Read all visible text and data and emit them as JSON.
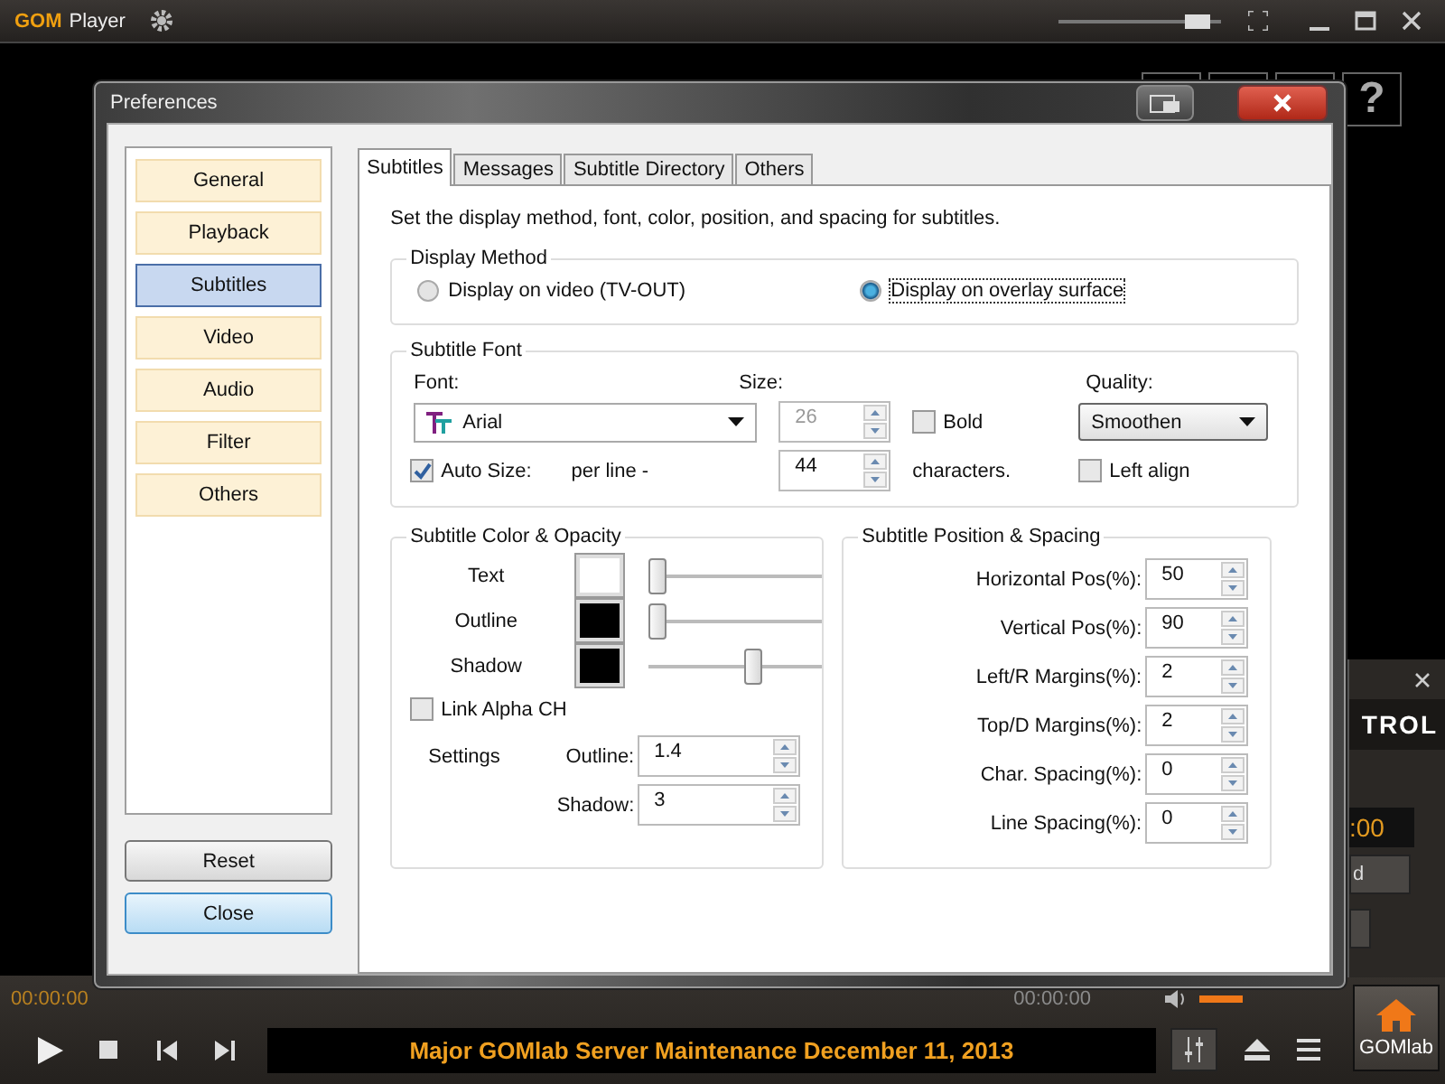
{
  "player_title_bar": {
    "logo": "GOM",
    "title": "Player",
    "volume": {
      "level": 0.85
    }
  },
  "help_button": {
    "label": "?"
  },
  "dialog": {
    "title": "Preferences",
    "categories": [
      {
        "label": "General",
        "selected": false
      },
      {
        "label": "Playback",
        "selected": false
      },
      {
        "label": "Subtitles",
        "selected": true
      },
      {
        "label": "Video",
        "selected": false
      },
      {
        "label": "Audio",
        "selected": false
      },
      {
        "label": "Filter",
        "selected": false
      },
      {
        "label": "Others",
        "selected": false
      }
    ],
    "buttons": [
      {
        "label": "Reset",
        "focused": false
      },
      {
        "label": "Close",
        "focused": true
      }
    ],
    "tabs": [
      {
        "label": "Subtitles",
        "selected": true
      },
      {
        "label": "Messages",
        "selected": false
      },
      {
        "label": "Subtitle Directory",
        "selected": false
      },
      {
        "label": "Others",
        "selected": false
      }
    ],
    "description": "Set the display method, font, color, position, and spacing for subtitles.",
    "display_method": {
      "title": "Display Method",
      "options": [
        {
          "label": "Display on video (TV-OUT)",
          "selected": false
        },
        {
          "label": "Display on overlay surface",
          "selected": true
        }
      ]
    },
    "subtitle_font": {
      "title": "Subtitle Font",
      "font_label": "Font:",
      "font_value": "Arial",
      "size_label": "Size:",
      "size_value": "26",
      "size_disabled": true,
      "bold": {
        "label": "Bold",
        "checked": false
      },
      "quality_label": "Quality:",
      "quality_value": "Smoothen",
      "auto_size": {
        "label": "Auto Size:",
        "checked": true
      },
      "per_line_label": "per line -",
      "per_line_value": "44",
      "characters_label": "characters.",
      "left_align": {
        "label": "Left align",
        "checked": false
      }
    },
    "color_opacity": {
      "title": "Subtitle Color & Opacity",
      "rows": [
        {
          "label": "Text",
          "color": "#ffffff",
          "level": 0.05
        },
        {
          "label": "Outline",
          "color": "#000000",
          "level": 0.05
        },
        {
          "label": "Shadow",
          "color": "#000000",
          "level": 0.6
        }
      ],
      "link_alpha": {
        "label": "Link Alpha CH",
        "checked": false
      },
      "settings_label": "Settings",
      "settings": [
        {
          "label": "Outline:",
          "value": "1.4"
        },
        {
          "label": "Shadow:",
          "value": "3"
        }
      ]
    },
    "position_spacing": {
      "title": "Subtitle Position & Spacing",
      "fields": [
        {
          "label": "Horizontal Pos(%):",
          "value": "50"
        },
        {
          "label": "Vertical Pos(%):",
          "value": "90"
        },
        {
          "label": "Left/R Margins(%):",
          "value": "2"
        },
        {
          "label": "Top/D Margins(%):",
          "value": "2"
        },
        {
          "label": "Char. Spacing(%):",
          "value": "0"
        },
        {
          "label": "Line Spacing(%):",
          "value": "0"
        }
      ]
    }
  },
  "control_panel": {
    "title": "TROL",
    "time": ":00",
    "button": "d"
  },
  "status": {
    "elapsed": "00:00:00",
    "total": "00:00:00",
    "volume": {
      "level": 1
    }
  },
  "ticker": "Major GOMlab Server Maintenance December 11, 2013",
  "home_button": {
    "label": "GOMlab"
  }
}
